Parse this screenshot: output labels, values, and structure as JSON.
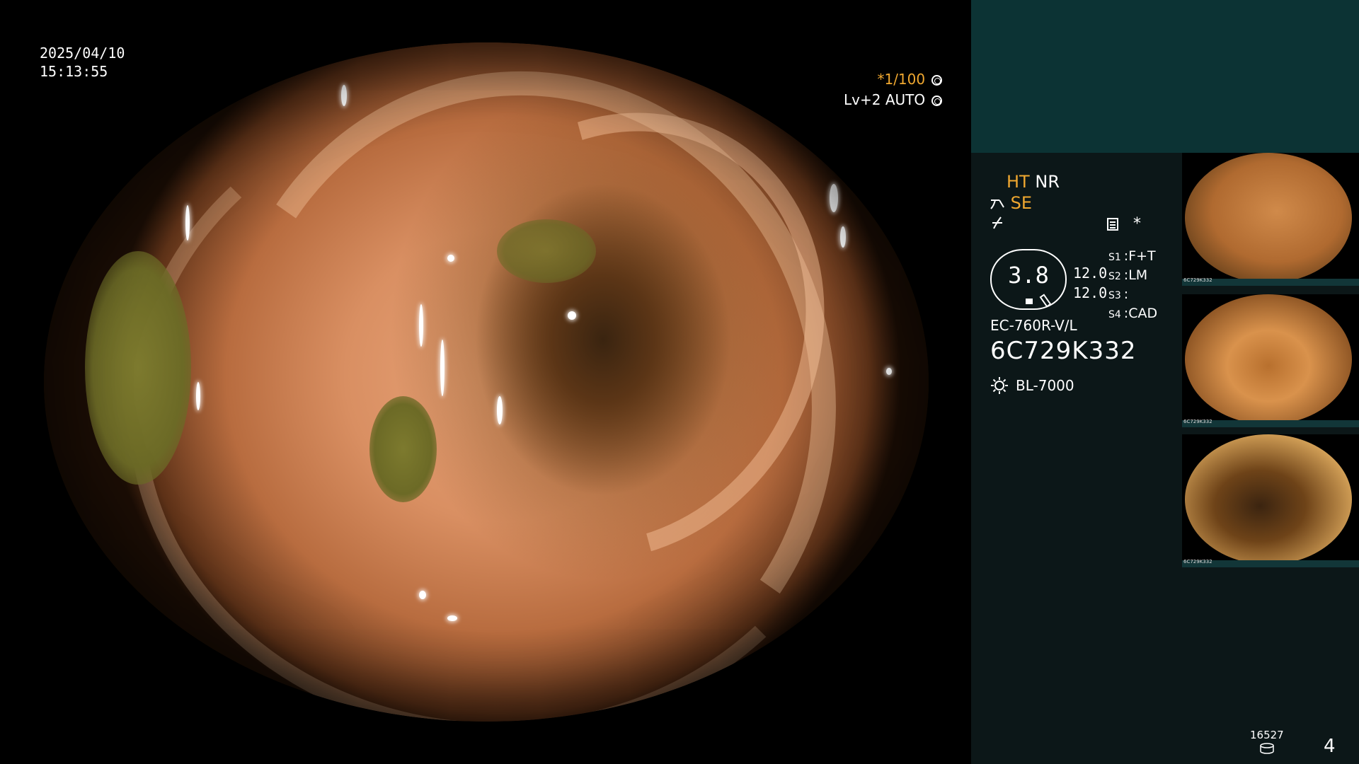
{
  "scope_view": {
    "date": "2025/04/10",
    "time": "15:13:55",
    "shutter": "*1/100",
    "shutter_icon": "aperture-icon",
    "level": "Lv+2 AUTO",
    "level_icon": "auto-exposure-icon"
  },
  "panel": {
    "mode_ht": "HT",
    "mode_nr": "NR",
    "se_label": "SE",
    "se_icon": "structure-enhance-icon",
    "enhance_icon": "edge-enhance-icon",
    "memo_icon": "document-icon",
    "star": "*",
    "zoom": {
      "value": "3.8",
      "levels": [
        "12.0",
        "12.0"
      ]
    },
    "switches": [
      {
        "key": "S1",
        "value": "F+T"
      },
      {
        "key": "S2",
        "value": "LM"
      },
      {
        "key": "S3",
        "value": ""
      },
      {
        "key": "S4",
        "value": "CAD"
      }
    ],
    "scope_model": "EC-760R-V/L",
    "scope_serial": "6C729K332",
    "light_source_icon": "sun-icon",
    "light_source": "BL-7000"
  },
  "thumbnails": [
    {
      "caption": "6C729K332"
    },
    {
      "caption": "6C729K332"
    },
    {
      "caption": "6C729K332"
    }
  ],
  "footer": {
    "capture_count": "16527",
    "capture_icon": "disk-icon",
    "page_number": "4"
  },
  "colors": {
    "highlight": "#f0a830",
    "panel_bg": "#0c1718",
    "panel_header_bg": "#0c3334"
  }
}
